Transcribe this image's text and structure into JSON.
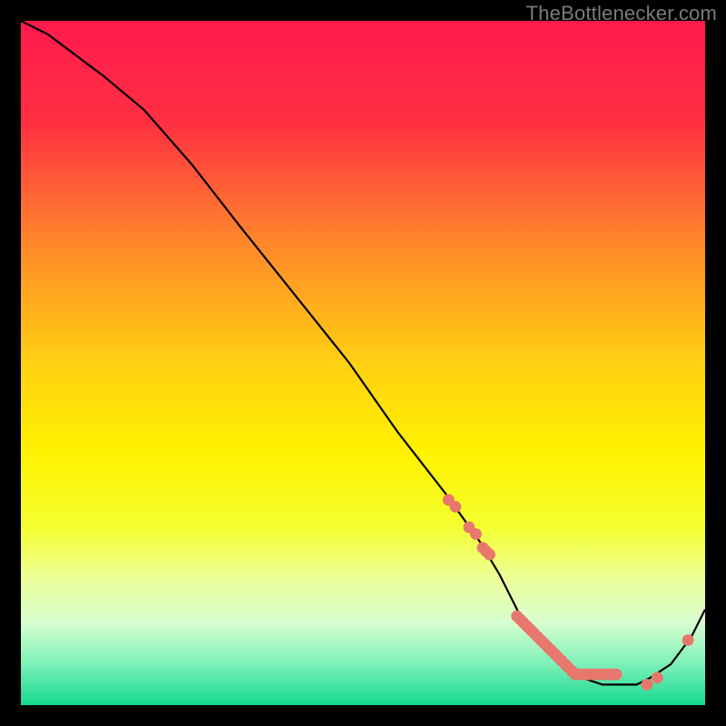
{
  "watermark": "TheBottlenecker.com",
  "colors": {
    "gradient_stops": [
      {
        "offset": 0.0,
        "color": "#ff1a4d"
      },
      {
        "offset": 0.15,
        "color": "#ff3042"
      },
      {
        "offset": 0.33,
        "color": "#ff8a2a"
      },
      {
        "offset": 0.5,
        "color": "#ffd012"
      },
      {
        "offset": 0.63,
        "color": "#fff200"
      },
      {
        "offset": 0.74,
        "color": "#f4ff30"
      },
      {
        "offset": 0.82,
        "color": "#ecffa0"
      },
      {
        "offset": 0.88,
        "color": "#d7ffd0"
      },
      {
        "offset": 0.94,
        "color": "#7df0b8"
      },
      {
        "offset": 1.0,
        "color": "#15d890"
      }
    ],
    "dot": "#e8776d",
    "curve": "#000000",
    "frame": "#000000"
  },
  "chart_data": {
    "type": "line",
    "title": "",
    "xlabel": "",
    "ylabel": "",
    "xlim": [
      0,
      100
    ],
    "ylim": [
      0,
      100
    ],
    "grid": false,
    "curve": {
      "x": [
        0,
        4,
        8,
        12,
        18,
        25,
        32,
        40,
        48,
        55,
        62,
        67,
        70,
        73,
        76,
        79,
        82,
        85,
        88,
        90,
        92,
        95,
        98,
        100
      ],
      "y": [
        100,
        98,
        95,
        92,
        87,
        79,
        70,
        60,
        50,
        40,
        31,
        24,
        19,
        13,
        9,
        6,
        4,
        3,
        3,
        3,
        4,
        6,
        10,
        14
      ]
    },
    "series": [
      {
        "name": "markers",
        "type": "scatter",
        "x": [
          62.5,
          63.5,
          65.5,
          66.5,
          67.5,
          68.0,
          68.5,
          72.5,
          73.0,
          73.5,
          74.0,
          74.5,
          75.0,
          75.5,
          76.0,
          76.5,
          77.0,
          77.5,
          78.0,
          78.5,
          79.0,
          79.5,
          80.0,
          80.5,
          81.0,
          81.5,
          82.0,
          82.5,
          83.0,
          83.5,
          84.0,
          84.5,
          85.0,
          85.5,
          86.0,
          86.5,
          87.0,
          91.5,
          93.0,
          97.5
        ],
        "y": [
          30.0,
          29.0,
          26.0,
          25.0,
          23.0,
          22.5,
          22.0,
          13.0,
          12.5,
          12.0,
          11.5,
          11.0,
          10.5,
          10.0,
          9.5,
          9.0,
          8.5,
          8.0,
          7.5,
          7.0,
          6.5,
          6.0,
          5.5,
          5.0,
          4.5,
          4.5,
          4.5,
          4.5,
          4.5,
          4.5,
          4.5,
          4.5,
          4.5,
          4.5,
          4.5,
          4.5,
          4.5,
          3.0,
          4.0,
          9.5
        ]
      }
    ]
  }
}
